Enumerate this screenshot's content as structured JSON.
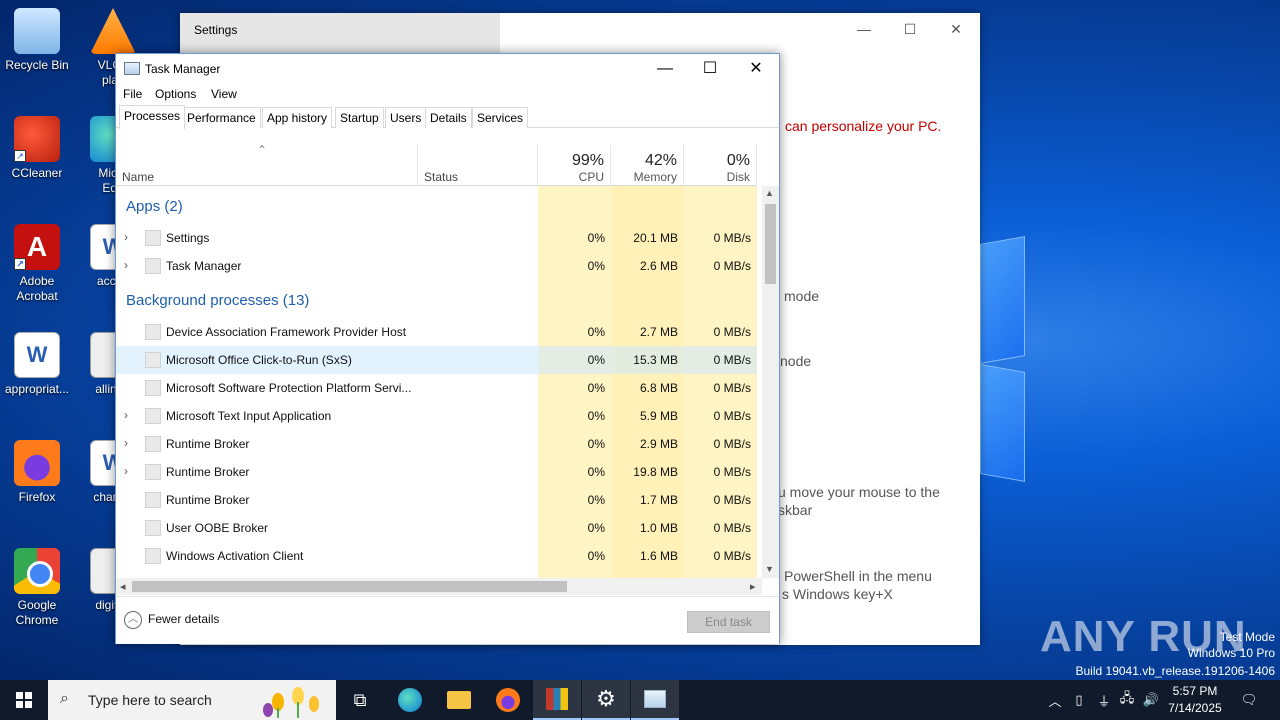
{
  "desktop": {
    "icons": [
      {
        "label": "Recycle Bin",
        "icon": "recycle-bin-icon"
      },
      {
        "label": "VLC media player",
        "short": "VLC r",
        "short2": "play",
        "icon": "vlc-icon"
      },
      {
        "label": "CCleaner",
        "icon": "ccleaner-icon"
      },
      {
        "label": "Microsoft Edge",
        "short": "Micro",
        "short2": "Edg",
        "icon": "edge-icon"
      },
      {
        "label": "Adobe Acrobat",
        "line1": "Adobe",
        "line2": "Acrobat",
        "icon": "acrobat-icon"
      },
      {
        "label": "accou",
        "icon": "word-doc-icon"
      },
      {
        "label": "appropriat...",
        "icon": "word-doc-icon"
      },
      {
        "label": "allinter",
        "icon": "image-file-icon"
      },
      {
        "label": "Firefox",
        "icon": "firefox-icon"
      },
      {
        "label": "change",
        "icon": "word-doc-icon"
      },
      {
        "label": "Google Chrome",
        "line1": "Google",
        "line2": "Chrome",
        "icon": "chrome-icon"
      },
      {
        "label": "digitalr",
        "icon": "image-file-icon"
      }
    ]
  },
  "settings_window": {
    "title": "Settings",
    "text_personalize": "can personalize your PC.",
    "text_mode1": "mode",
    "text_mode2": "node",
    "text_mouse1": "u move your mouse to the",
    "text_mouse2": "skbar",
    "text_ps1": "PowerShell in the menu",
    "text_ps2": "s Windows key+X"
  },
  "task_manager": {
    "title": "Task Manager",
    "menu": [
      "File",
      "Options",
      "View"
    ],
    "tabs": [
      "Processes",
      "Performance",
      "App history",
      "Startup",
      "Users",
      "Details",
      "Services"
    ],
    "active_tab": "Processes",
    "columns": {
      "name": "Name",
      "status": "Status",
      "cpu": {
        "pct": "99%",
        "label": "CPU"
      },
      "memory": {
        "pct": "42%",
        "label": "Memory"
      },
      "disk": {
        "pct": "0%",
        "label": "Disk"
      }
    },
    "groups": {
      "apps": "Apps (2)",
      "background": "Background processes (13)"
    },
    "apps": [
      {
        "name": "Settings",
        "cpu": "0%",
        "memory": "20.1 MB",
        "disk": "0 MB/s",
        "expandable": true
      },
      {
        "name": "Task Manager",
        "cpu": "0%",
        "memory": "2.6 MB",
        "disk": "0 MB/s",
        "expandable": true
      }
    ],
    "background": [
      {
        "name": "Device Association Framework Provider Host",
        "cpu": "0%",
        "memory": "2.7 MB",
        "disk": "0 MB/s",
        "expandable": false
      },
      {
        "name": "Microsoft Office Click-to-Run (SxS)",
        "cpu": "0%",
        "memory": "15.3 MB",
        "disk": "0 MB/s",
        "expandable": false
      },
      {
        "name": "Microsoft Software Protection Platform Servi...",
        "cpu": "0%",
        "memory": "6.8 MB",
        "disk": "0 MB/s",
        "expandable": false
      },
      {
        "name": "Microsoft Text Input Application",
        "cpu": "0%",
        "memory": "5.9 MB",
        "disk": "0 MB/s",
        "expandable": true
      },
      {
        "name": "Runtime Broker",
        "cpu": "0%",
        "memory": "2.9 MB",
        "disk": "0 MB/s",
        "expandable": true
      },
      {
        "name": "Runtime Broker",
        "cpu": "0%",
        "memory": "19.8 MB",
        "disk": "0 MB/s",
        "expandable": true
      },
      {
        "name": "Runtime Broker",
        "cpu": "0%",
        "memory": "1.7 MB",
        "disk": "0 MB/s",
        "expandable": false
      },
      {
        "name": "User OOBE Broker",
        "cpu": "0%",
        "memory": "1.0 MB",
        "disk": "0 MB/s",
        "expandable": false
      },
      {
        "name": "Windows Activation Client",
        "cpu": "0%",
        "memory": "1.6 MB",
        "disk": "0 MB/s",
        "expandable": false
      }
    ],
    "fewer_details": "Fewer details",
    "end_task": "End task"
  },
  "watermark": {
    "brand": "ANY RUN",
    "line1": "Test Mode",
    "line2": "Windows 10 Pro",
    "line3": "Build 19041.vb_release.191206-1406"
  },
  "taskbar": {
    "search_placeholder": "Type here to search",
    "time": "5:57 PM",
    "date": "7/14/2025"
  },
  "colors": {
    "group_header": "#1f5fad",
    "cpu_highlight": "#fff4c4",
    "taskbar_bg": "#101a2a"
  }
}
